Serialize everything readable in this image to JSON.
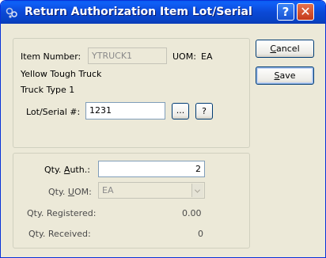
{
  "window": {
    "title": "Return Authorization Item Lot/Serial"
  },
  "item": {
    "number_label": "Item Number:",
    "number_value": "YTRUCK1",
    "uom_label": "UOM:",
    "uom_value": "EA",
    "desc1": "Yellow Tough Truck",
    "desc2": "Truck Type 1"
  },
  "lot": {
    "label": "Lot/Serial #:",
    "value": "1231",
    "browse_label": "...",
    "help_label": "?"
  },
  "qty": {
    "auth_label": "Qty. Auth.:",
    "auth_value": "2",
    "uom_label": "Qty. UOM:",
    "uom_value": "EA",
    "registered_label": "Qty. Registered:",
    "registered_value": "0.00",
    "received_label": "Qty. Received:",
    "received_value": "0"
  },
  "buttons": {
    "cancel": "Cancel",
    "save": "Save"
  }
}
